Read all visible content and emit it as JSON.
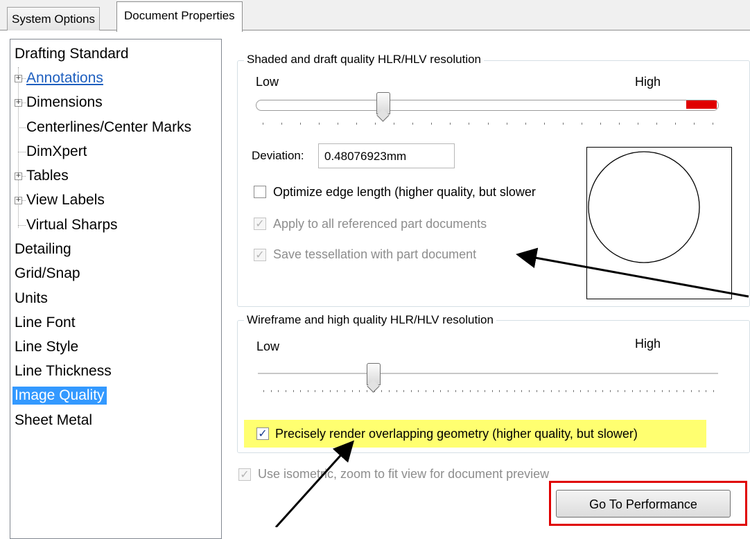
{
  "tabs": [
    {
      "label": "System Options",
      "active": false
    },
    {
      "label": "Document Properties",
      "active": true
    }
  ],
  "tree": {
    "items": [
      {
        "label": "Drafting Standard"
      },
      {
        "label": "Annotations"
      },
      {
        "label": "Dimensions"
      },
      {
        "label": "Centerlines/Center Marks"
      },
      {
        "label": "DimXpert"
      },
      {
        "label": "Tables"
      },
      {
        "label": "View Labels"
      },
      {
        "label": "Virtual Sharps"
      },
      {
        "label": "Detailing"
      },
      {
        "label": "Grid/Snap"
      },
      {
        "label": "Units"
      },
      {
        "label": "Line Font"
      },
      {
        "label": "Line Style"
      },
      {
        "label": "Line Thickness"
      },
      {
        "label": "Image Quality",
        "selected": true
      },
      {
        "label": "Sheet Metal"
      }
    ],
    "selected_color": "#3399ff",
    "link_color": "#1e5fbf"
  },
  "shaded": {
    "title": "Shaded and draft quality HLR/HLV resolution",
    "low_label": "Low",
    "high_label": "High",
    "slider_level_percent": 28,
    "deviation_label": "Deviation:",
    "deviation_value": "0.48076923mm",
    "optimize_label": "Optimize edge length (higher quality, but slower",
    "optimize_checked": false,
    "apply_label": "Apply to all referenced part documents",
    "apply_checked": true,
    "save_label": "Save tessellation with part document",
    "save_checked": true
  },
  "wireframe": {
    "title": "Wireframe and high quality HLR/HLV resolution",
    "low_label": "Low",
    "high_label": "High",
    "slider_level_percent": 25,
    "precise_label": "Precisely render overlapping geometry (higher quality, but slower)",
    "precise_checked": true
  },
  "isometric": {
    "label": "Use isometric, zoom to fit view for document preview",
    "checked": true
  },
  "buttons": {
    "performance": "Go To Performance"
  },
  "colors": {
    "highlight": "#ffff70",
    "red_annotation": "#e00000",
    "arrow": "#000000"
  },
  "icons": {
    "expand": "plus-box-icon",
    "check": "checkmark-icon"
  }
}
